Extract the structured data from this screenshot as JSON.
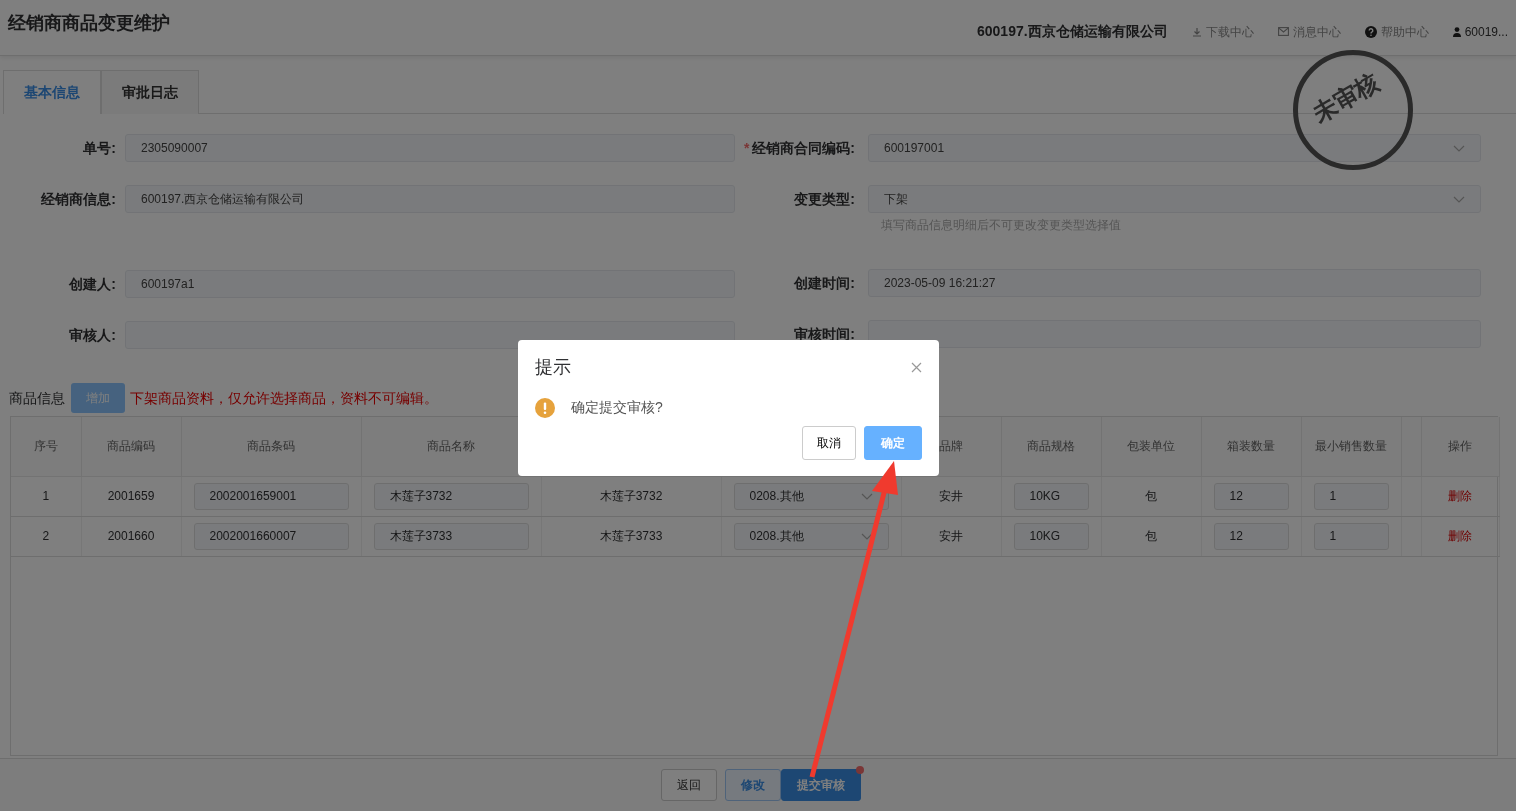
{
  "header": {
    "title": "经销商商品变更维护",
    "company": "600197.西京仓储运输有限公司",
    "links": [
      {
        "label": "下载中心"
      },
      {
        "label": "消息中心"
      },
      {
        "label": "帮助中心"
      },
      {
        "label": "60019..."
      }
    ]
  },
  "tabs": [
    {
      "label": "基本信息",
      "selected": true
    },
    {
      "label": "审批日志",
      "selected": false
    }
  ],
  "stamp": {
    "text": "未审核"
  },
  "form": {
    "left": [
      {
        "label": "单号:",
        "value": "2305090007"
      },
      {
        "label": "经销商信息:",
        "value": "600197.西京仓储运输有限公司"
      },
      {
        "label": "创建人:",
        "value": "600197a1"
      },
      {
        "label": "审核人:"
      }
    ],
    "right": [
      {
        "label": "经销商合同编码:",
        "required_mark": "*",
        "kind": "select",
        "value": "600197001"
      },
      {
        "label": "变更类型:",
        "kind": "select",
        "value": "下架",
        "hint": "填写商品信息明细后不可更改变更类型选择值"
      },
      {
        "label": "创建时间:",
        "kind": "input",
        "value": "2023-05-09 16:21:27"
      },
      {
        "label": "审核时间:",
        "kind": "input"
      }
    ]
  },
  "products": {
    "title": "商品信息",
    "add_button": "增加",
    "notice": "下架商品资料，仅允许选择商品，资料不可编辑。",
    "columns": [
      {
        "label": "序号"
      },
      {
        "label": "商品编码"
      },
      {
        "label": "商品条码"
      },
      {
        "label": "商品名称"
      },
      {},
      {},
      {
        "label": "品牌"
      },
      {
        "label": "商品规格"
      },
      {
        "label": "包装单位"
      },
      {
        "label": "箱装数量"
      },
      {
        "label": "最小销售数量"
      },
      {},
      {
        "label": "操作"
      }
    ],
    "rows": [
      {
        "cells": [
          {
            "kind": "text",
            "value": "1"
          },
          {
            "kind": "text",
            "value": "2001659"
          },
          {
            "kind": "input",
            "value": "2002001659001"
          },
          {
            "kind": "input",
            "value": "木莲子3732"
          },
          {
            "kind": "plain",
            "value": "木莲子3732"
          },
          {
            "kind": "select",
            "value": "0208.其他"
          },
          {
            "kind": "text",
            "value": "安井"
          },
          {
            "kind": "input",
            "value": "10KG"
          },
          {
            "kind": "text",
            "value": "包"
          },
          {
            "kind": "input",
            "value": "12"
          },
          {
            "kind": "input",
            "value": "1"
          },
          {
            "kind": "edge"
          },
          {
            "kind": "link",
            "value": "删除"
          }
        ]
      },
      {
        "cells": [
          {
            "kind": "text",
            "value": "2"
          },
          {
            "kind": "text",
            "value": "2001660"
          },
          {
            "kind": "input",
            "value": "2002001660007"
          },
          {
            "kind": "input",
            "value": "木莲子3733"
          },
          {
            "kind": "plain",
            "value": "木莲子3733"
          },
          {
            "kind": "select",
            "value": "0208.其他"
          },
          {
            "kind": "text",
            "value": "安井"
          },
          {
            "kind": "input",
            "value": "10KG"
          },
          {
            "kind": "text",
            "value": "包"
          },
          {
            "kind": "input",
            "value": "12"
          },
          {
            "kind": "input",
            "value": "1"
          },
          {
            "kind": "edge"
          },
          {
            "kind": "link",
            "value": "删除"
          }
        ]
      }
    ]
  },
  "footer": {
    "buttons": [
      {
        "label": "返回",
        "kind": "default",
        "dot": false
      },
      {
        "label": "修改",
        "kind": "plain",
        "dot": false
      },
      {
        "label": "提交审核",
        "kind": "primary",
        "dot": true
      }
    ]
  },
  "dialog": {
    "title": "提示",
    "message": "确定提交审核?",
    "buttons": [
      {
        "label": "取消",
        "kind": "default"
      },
      {
        "label": "确定",
        "kind": "primary"
      }
    ]
  },
  "annotation": {
    "arrow": true
  }
}
